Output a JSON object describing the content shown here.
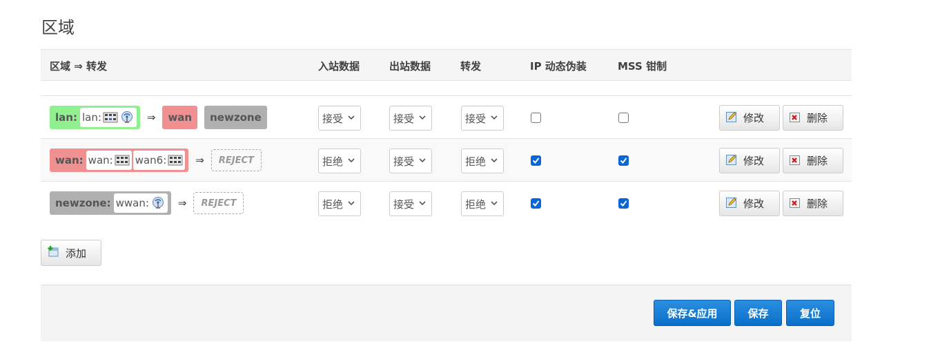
{
  "page_title": "区域",
  "headers": {
    "zone_forward": "区域 ⇒ 转发",
    "input": "入站数据",
    "output": "出站数据",
    "forward": "转发",
    "masq": "IP 动态伪装",
    "mss": "MSS 钳制"
  },
  "arrow": "⇒",
  "colors": {
    "lan": "#90f090",
    "wan": "#f09090",
    "newzone": "#b0b0b0",
    "primary": "#0a6fc8"
  },
  "zones": [
    {
      "name": "lan:",
      "color": "#90f090",
      "networks": [
        {
          "label": "lan:",
          "icons": [
            "ethernet-switch-icon",
            "wifi-antenna-icon"
          ]
        }
      ],
      "forwards": [
        {
          "label": "wan",
          "color": "#f09090"
        },
        {
          "label": "newzone",
          "color": "#b0b0b0"
        }
      ],
      "reject": null,
      "input": "接受",
      "output": "接受",
      "forward": "接受",
      "masq": false,
      "mss": false
    },
    {
      "name": "wan:",
      "color": "#f09090",
      "networks": [
        {
          "label": "wan:",
          "icons": [
            "ethernet-port-icon"
          ]
        },
        {
          "label": "wan6:",
          "icons": [
            "ethernet-port-icon"
          ]
        }
      ],
      "forwards": [],
      "reject": "REJECT",
      "input": "拒绝",
      "output": "接受",
      "forward": "拒绝",
      "masq": true,
      "mss": true
    },
    {
      "name": "newzone:",
      "color": "#b0b0b0",
      "networks": [
        {
          "label": "wwan:",
          "icons": [
            "wifi-antenna-icon"
          ]
        }
      ],
      "forwards": [],
      "reject": "REJECT",
      "input": "拒绝",
      "output": "接受",
      "forward": "拒绝",
      "masq": true,
      "mss": true
    }
  ],
  "buttons": {
    "edit": "修改",
    "delete": "删除",
    "add": "添加",
    "save_apply": "保存&应用",
    "save": "保存",
    "reset": "复位"
  }
}
